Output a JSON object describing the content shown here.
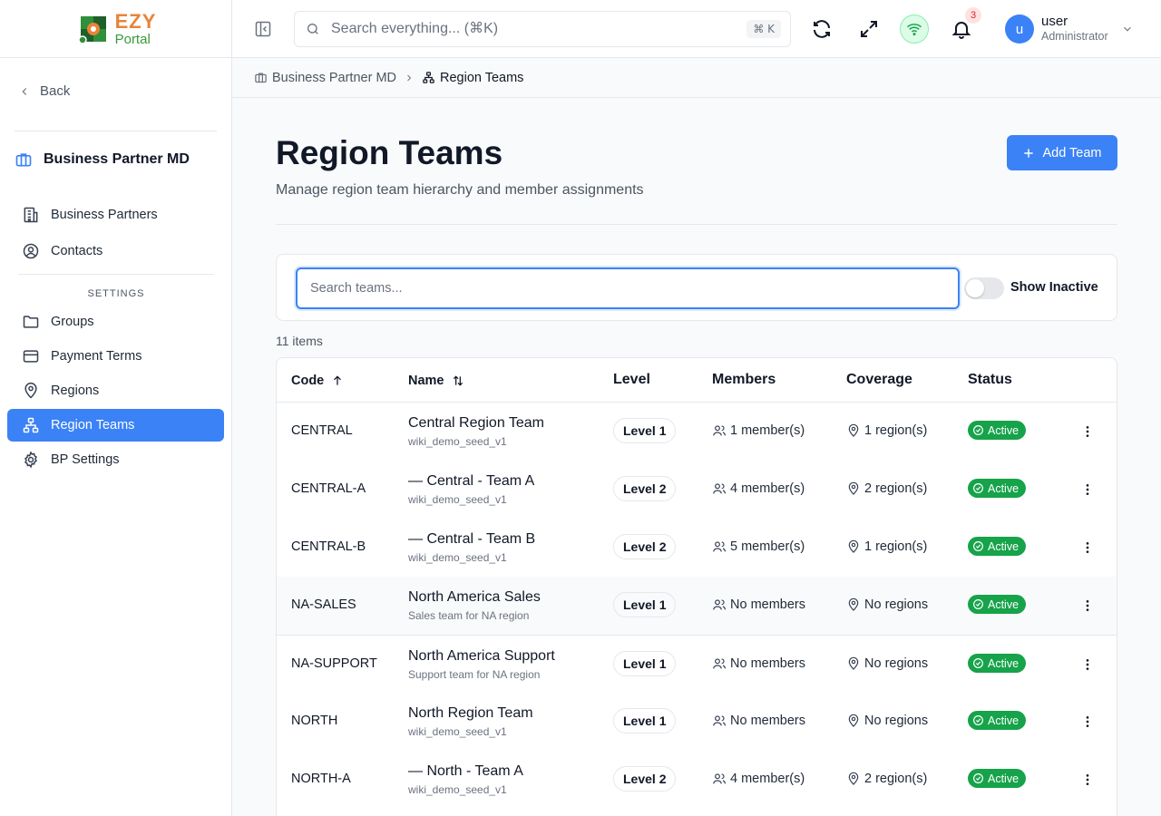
{
  "logo": {
    "brand": "EZY",
    "product": "Portal"
  },
  "sidebar": {
    "back_label": "Back",
    "module_title": "Business Partner MD",
    "items": [
      {
        "label": "Business Partners",
        "icon": "building-icon"
      },
      {
        "label": "Contacts",
        "icon": "user-circle-icon"
      }
    ],
    "section_label": "SETTINGS",
    "settings_items": [
      {
        "label": "Groups",
        "icon": "folder-icon"
      },
      {
        "label": "Payment Terms",
        "icon": "credit-card-icon"
      },
      {
        "label": "Regions",
        "icon": "map-pin-icon"
      },
      {
        "label": "Region Teams",
        "icon": "network-icon",
        "active": true
      },
      {
        "label": "BP Settings",
        "icon": "gear-icon"
      }
    ]
  },
  "header": {
    "search_placeholder": "Search everything... (⌘K)",
    "search_shortcut": "⌘ K",
    "notification_count": "3",
    "user": {
      "initial": "u",
      "name": "user",
      "role": "Administrator"
    },
    "wifi_status_color": "#16a34a"
  },
  "breadcrumb": {
    "parent": "Business Partner MD",
    "current": "Region Teams"
  },
  "page": {
    "title": "Region Teams",
    "subtitle": "Manage region team hierarchy and member assignments",
    "add_button": "Add Team"
  },
  "filters": {
    "search_placeholder": "Search teams...",
    "show_inactive_label": "Show Inactive",
    "show_inactive": false
  },
  "items_count": "11 items",
  "table": {
    "columns": {
      "code": "Code",
      "name": "Name",
      "level": "Level",
      "members": "Members",
      "coverage": "Coverage",
      "status": "Status"
    },
    "rows": [
      {
        "code": "CENTRAL",
        "name": "Central Region Team",
        "sub": "wiki_demo_seed_v1",
        "level": "Level 1",
        "members": "1 member(s)",
        "coverage": "1 region(s)",
        "status": "Active"
      },
      {
        "code": "CENTRAL-A",
        "name": "— Central - Team A",
        "sub": "wiki_demo_seed_v1",
        "level": "Level 2",
        "members": "4 member(s)",
        "coverage": "2 region(s)",
        "status": "Active"
      },
      {
        "code": "CENTRAL-B",
        "name": "— Central - Team B",
        "sub": "wiki_demo_seed_v1",
        "level": "Level 2",
        "members": "5 member(s)",
        "coverage": "1 region(s)",
        "status": "Active"
      },
      {
        "code": "NA-SALES",
        "name": "North America Sales",
        "sub": "Sales team for NA region",
        "level": "Level 1",
        "members": "No members",
        "coverage": "No regions",
        "status": "Active"
      },
      {
        "code": "NA-SUPPORT",
        "name": "North America Support",
        "sub": "Support team for NA region",
        "level": "Level 1",
        "members": "No members",
        "coverage": "No regions",
        "status": "Active"
      },
      {
        "code": "NORTH",
        "name": "North Region Team",
        "sub": "wiki_demo_seed_v1",
        "level": "Level 1",
        "members": "No members",
        "coverage": "No regions",
        "status": "Active"
      },
      {
        "code": "NORTH-A",
        "name": "— North - Team A",
        "sub": "wiki_demo_seed_v1",
        "level": "Level 2",
        "members": "4 member(s)",
        "coverage": "2 region(s)",
        "status": "Active"
      }
    ]
  },
  "colors": {
    "accent": "#3b82f6",
    "active_status": "#16a34a",
    "badge": "#dc2626"
  }
}
